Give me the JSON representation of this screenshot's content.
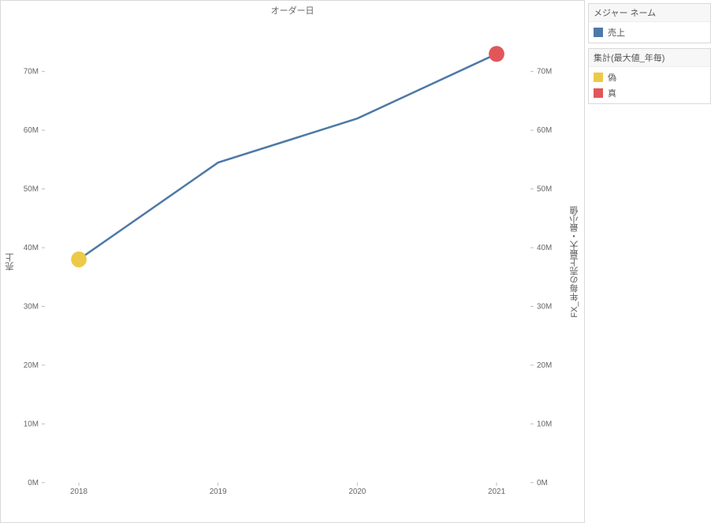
{
  "chart_data": {
    "type": "line",
    "title": "オーダー日",
    "xlabel": "",
    "ylabel_left": "売上",
    "ylabel_right": "FX_年毎の売上最大・最小値",
    "x": [
      2018,
      2019,
      2020,
      2021
    ],
    "series": [
      {
        "name": "売上",
        "values": [
          38000000,
          54500000,
          62000000,
          73000000
        ],
        "color": "#4e79a7"
      }
    ],
    "markers": [
      {
        "x": 2018,
        "y": 38000000,
        "label": "偽",
        "color": "#edc948"
      },
      {
        "x": 2021,
        "y": 73000000,
        "label": "真",
        "color": "#e15759"
      }
    ],
    "y_ticks_M": [
      0,
      10,
      20,
      30,
      40,
      50,
      60,
      70
    ],
    "ylim": [
      0,
      78000000
    ]
  },
  "legend": {
    "block1_title": "メジャー ネーム",
    "block1_items": [
      {
        "label": "売上",
        "swatch": "line"
      }
    ],
    "block2_title": "集計(最大値_年毎)",
    "block2_items": [
      {
        "label": "偽",
        "swatch": "yellow"
      },
      {
        "label": "真",
        "swatch": "red"
      }
    ]
  }
}
